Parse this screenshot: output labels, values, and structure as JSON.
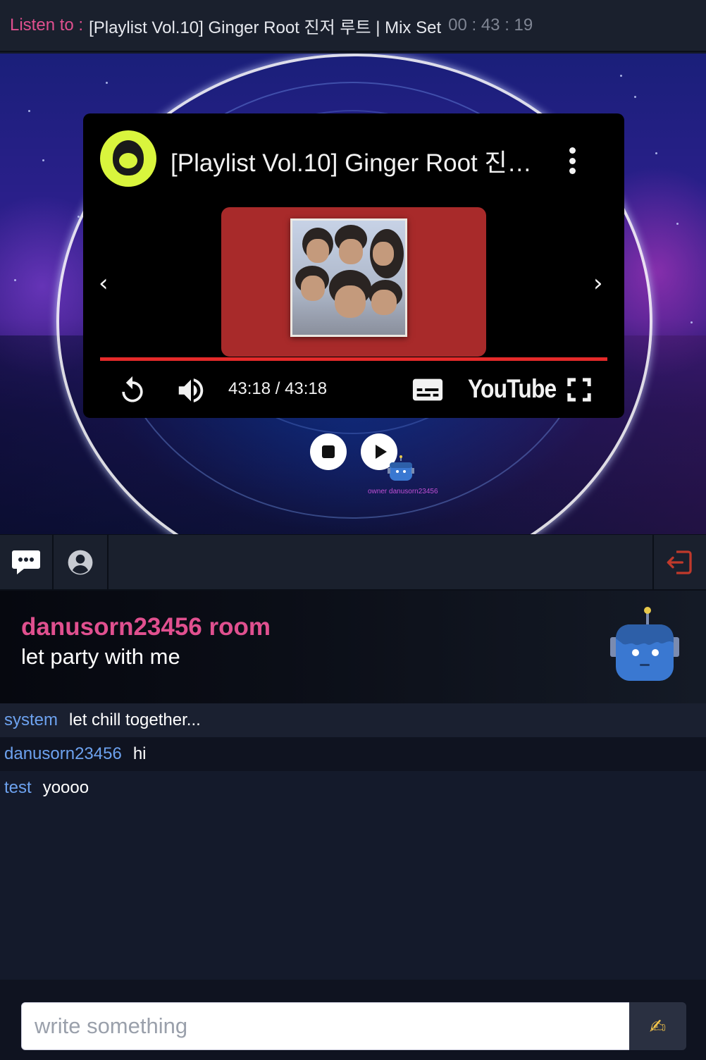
{
  "now_playing": {
    "label": "Listen to :",
    "title": "[Playlist Vol.10] Ginger Root 진저 루트 |  Mix Set",
    "timer": "00 : 43 : 19"
  },
  "video": {
    "title": "[Playlist Vol.10] Ginger Root 진저 루트 | Mix Set",
    "time": "43:18 / 43:18",
    "brand": "YouTube",
    "progress": 1.0
  },
  "owner_label": "owner danusorn23456",
  "room": {
    "title": "danusorn23456 room",
    "subtitle": "let party with me"
  },
  "messages": [
    {
      "user": "system",
      "text": "let chill together..."
    },
    {
      "user": "danusorn23456",
      "text": "hi"
    },
    {
      "user": "test",
      "text": "yoooo"
    }
  ],
  "compose": {
    "placeholder": "write something",
    "send_icon": "✍"
  },
  "icons": {
    "chat": "chat-bubble-icon",
    "users": "user-circle-icon",
    "exit": "exit-icon"
  },
  "colors": {
    "accent_pink": "#e0508f",
    "username_blue": "#6da2ef",
    "exit_red": "#c0392b",
    "progress_red": "#e52a2a"
  }
}
